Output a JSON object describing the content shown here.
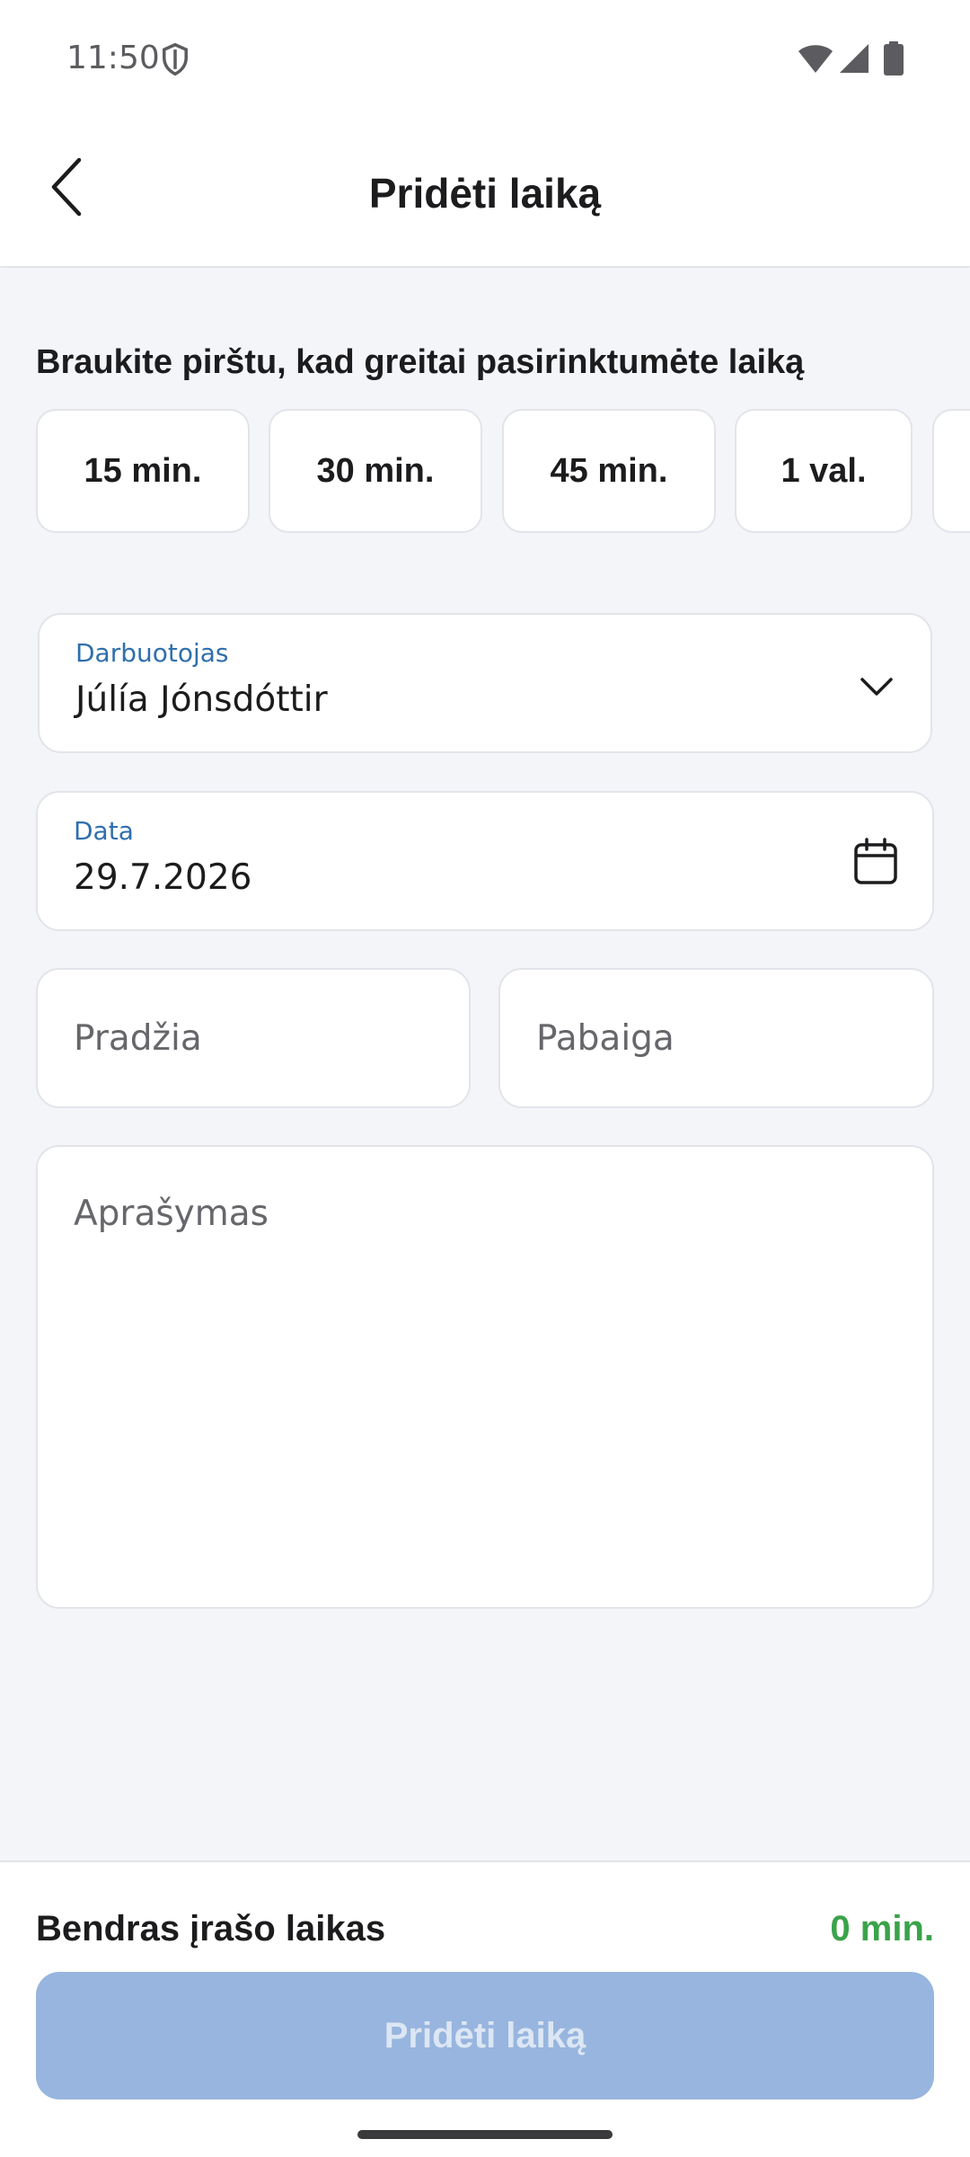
{
  "status_bar": {
    "time": "11:50"
  },
  "header": {
    "title": "Pridėti laiką"
  },
  "quick_select": {
    "hint": "Braukite pirštu, kad greitai pasirinktumėte laiką",
    "chips": [
      "15 min.",
      "30 min.",
      "45 min.",
      "1 val.",
      ""
    ]
  },
  "form": {
    "employee": {
      "label": "Darbuotojas",
      "value": "Júlía Jónsdóttir"
    },
    "date": {
      "label": "Data",
      "value": "29.7.2026"
    },
    "start": {
      "placeholder": "Pradžia"
    },
    "end": {
      "placeholder": "Pabaiga"
    },
    "description": {
      "placeholder": "Aprašymas"
    }
  },
  "footer": {
    "total_label": "Bendras įrašo laikas",
    "total_value": "0 min.",
    "submit_label": "Pridėti laiką"
  },
  "colors": {
    "accent_label": "#2f6fad",
    "total_value": "#3aa34a",
    "submit_disabled_bg": "#97b5de"
  }
}
